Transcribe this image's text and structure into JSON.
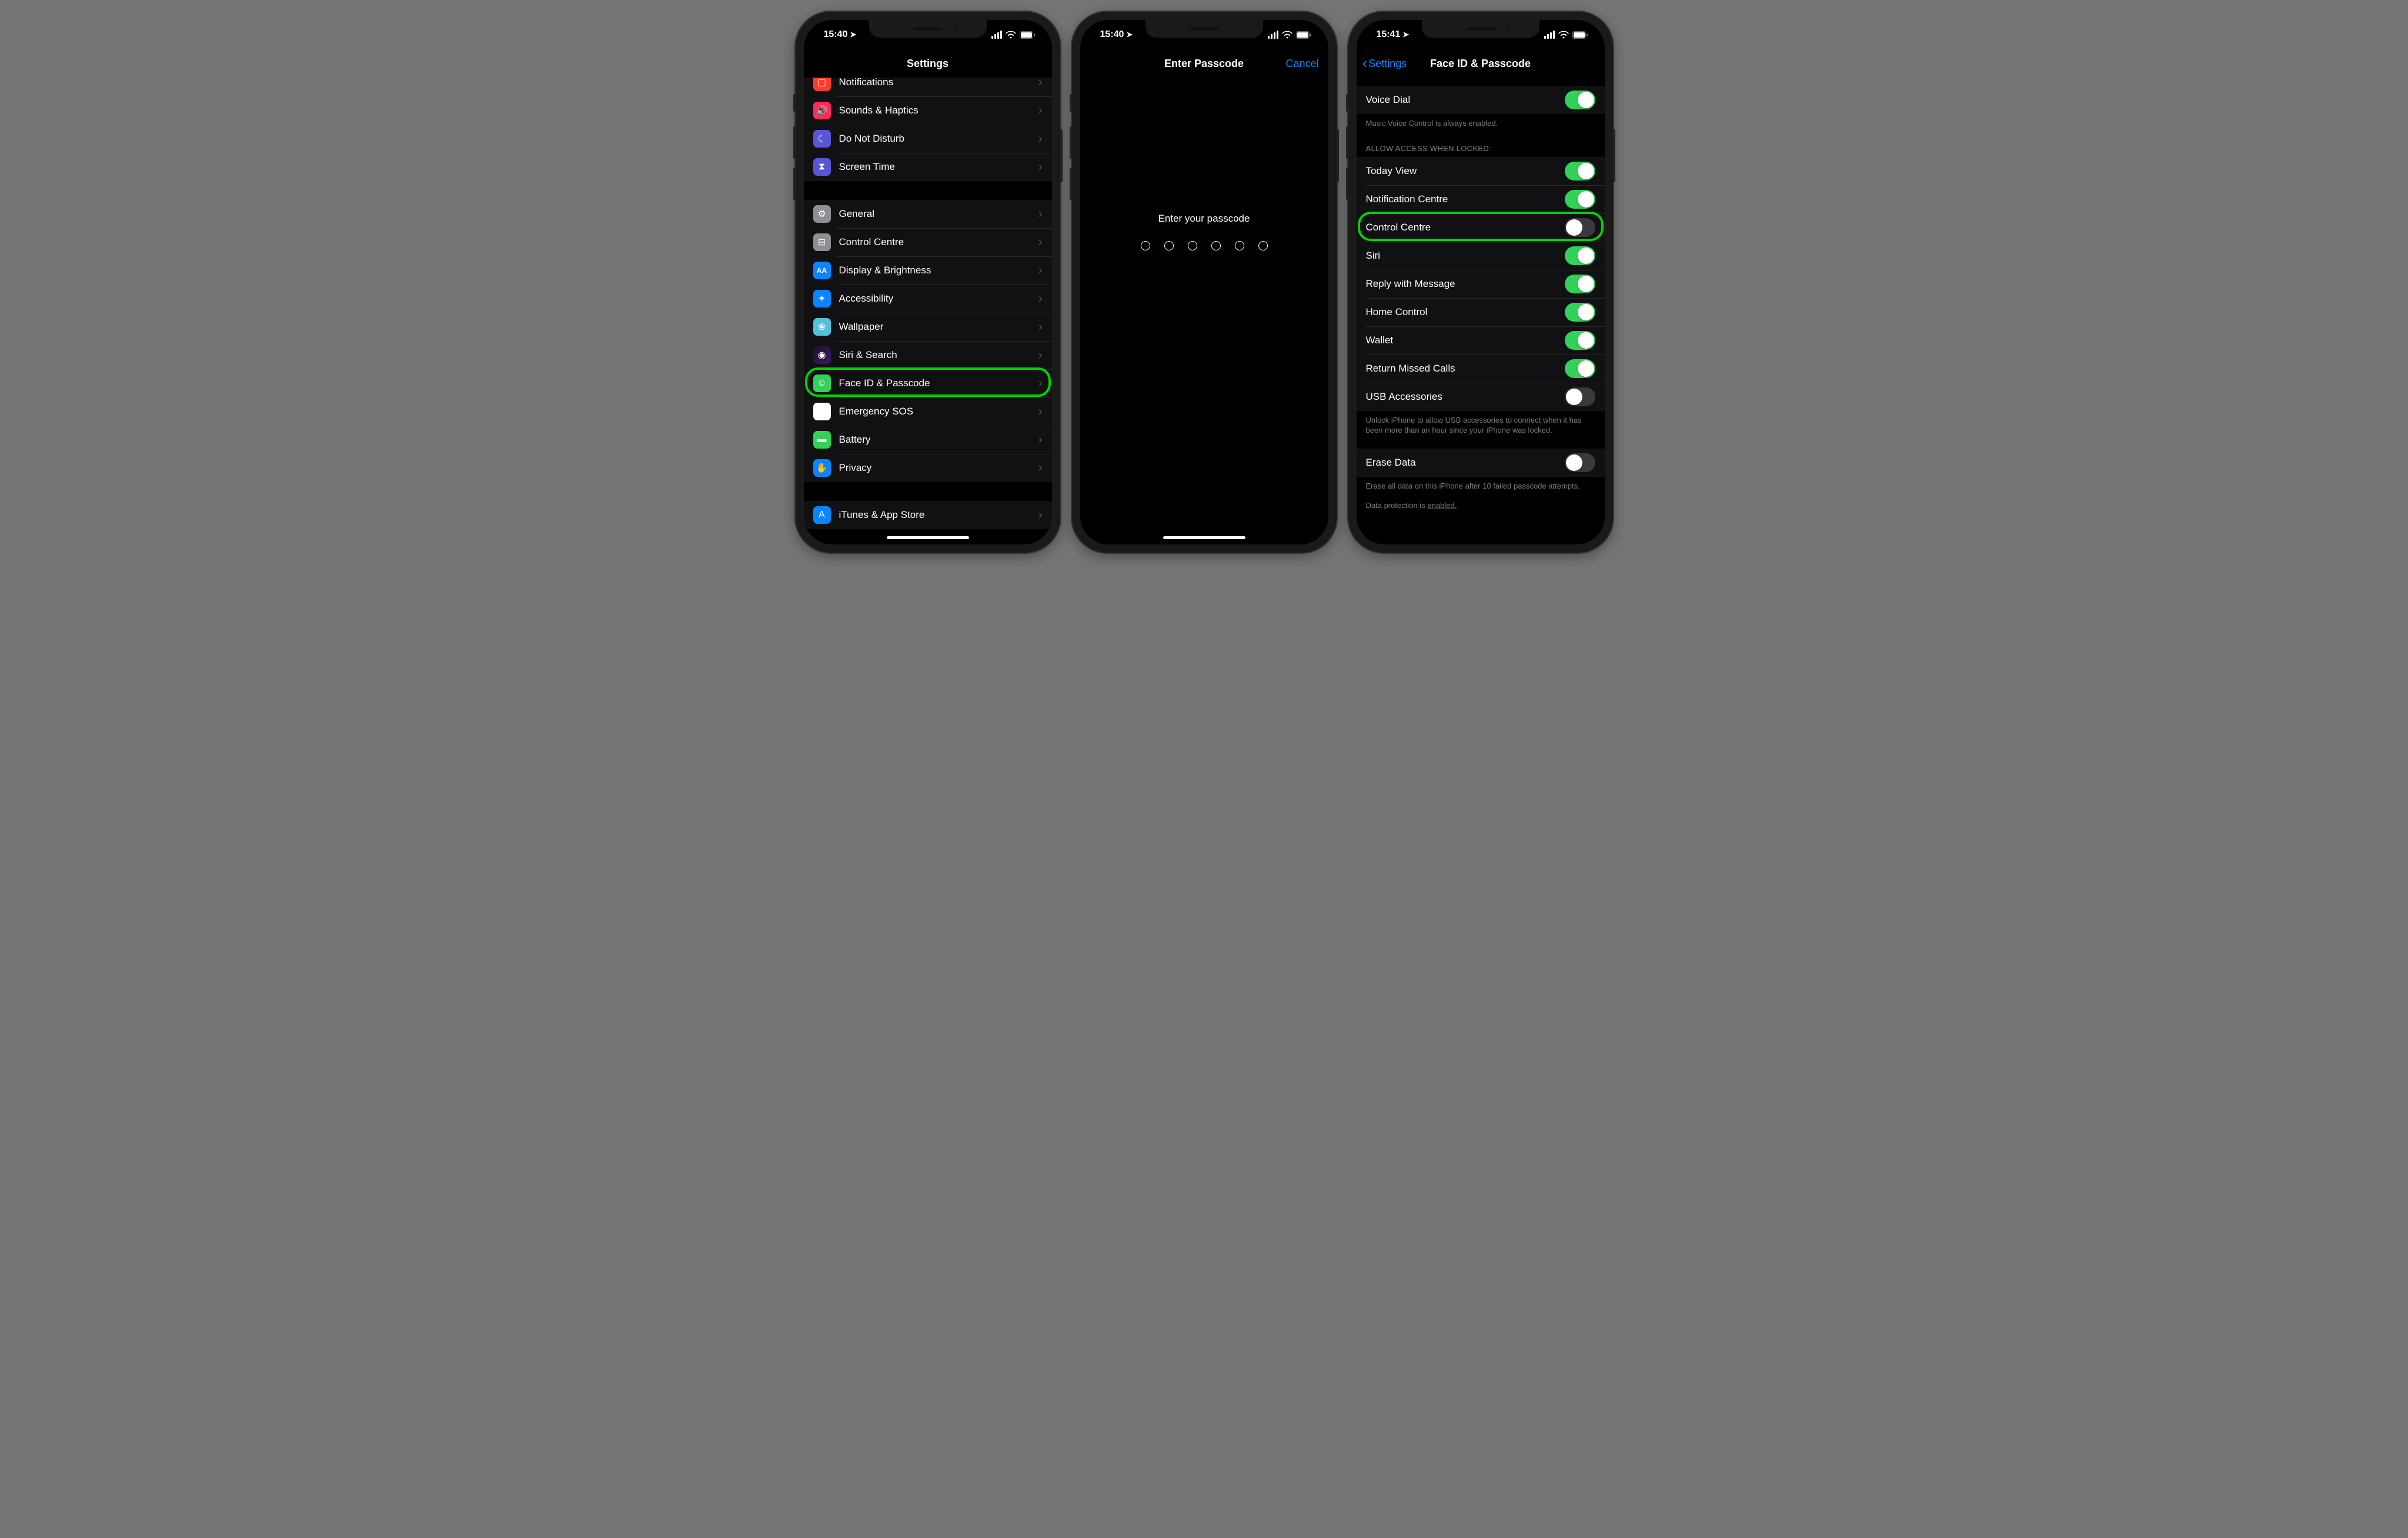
{
  "status": {
    "time_a": "15:40",
    "time_b": "15:40",
    "time_c": "15:41"
  },
  "phone1": {
    "title": "Settings",
    "rows1": [
      {
        "key": "notifications",
        "label": "Notifications",
        "icon": "bell-icon"
      },
      {
        "key": "sounds",
        "label": "Sounds & Haptics",
        "icon": "speaker-icon"
      },
      {
        "key": "dnd",
        "label": "Do Not Disturb",
        "icon": "moon-icon"
      },
      {
        "key": "screentime",
        "label": "Screen Time",
        "icon": "hourglass-icon"
      }
    ],
    "rows2": [
      {
        "key": "general",
        "label": "General",
        "icon": "gear-icon"
      },
      {
        "key": "controlcentre",
        "label": "Control Centre",
        "icon": "toggles-icon"
      },
      {
        "key": "display",
        "label": "Display & Brightness",
        "icon": "aa-icon"
      },
      {
        "key": "accessibility",
        "label": "Accessibility",
        "icon": "person-icon"
      },
      {
        "key": "wallpaper",
        "label": "Wallpaper",
        "icon": "flower-icon"
      },
      {
        "key": "siri",
        "label": "Siri & Search",
        "icon": "siri-icon"
      },
      {
        "key": "faceid",
        "label": "Face ID & Passcode",
        "icon": "face-icon"
      },
      {
        "key": "sos",
        "label": "Emergency SOS",
        "icon": "sos-icon"
      },
      {
        "key": "battery",
        "label": "Battery",
        "icon": "battery-icon"
      },
      {
        "key": "privacy",
        "label": "Privacy",
        "icon": "hand-icon"
      }
    ],
    "rows3": [
      {
        "key": "itunes",
        "label": "iTunes & App Store",
        "icon": "appstore-icon"
      }
    ],
    "highlighted": "faceid"
  },
  "phone2": {
    "title": "Enter Passcode",
    "cancel": "Cancel",
    "prompt": "Enter your passcode",
    "dots": 6
  },
  "phone3": {
    "back": "Settings",
    "title": "Face ID & Passcode",
    "voice_dial": {
      "label": "Voice Dial",
      "on": true
    },
    "voice_footer": "Music Voice Control is always enabled.",
    "allow_header": "ALLOW ACCESS WHEN LOCKED:",
    "allow_rows": [
      {
        "key": "today",
        "label": "Today View",
        "on": true
      },
      {
        "key": "notif",
        "label": "Notification Centre",
        "on": true
      },
      {
        "key": "cc",
        "label": "Control Centre",
        "on": false
      },
      {
        "key": "siri",
        "label": "Siri",
        "on": true
      },
      {
        "key": "reply",
        "label": "Reply with Message",
        "on": true
      },
      {
        "key": "home",
        "label": "Home Control",
        "on": true
      },
      {
        "key": "wallet",
        "label": "Wallet",
        "on": true
      },
      {
        "key": "missed",
        "label": "Return Missed Calls",
        "on": true
      },
      {
        "key": "usb",
        "label": "USB Accessories",
        "on": false
      }
    ],
    "usb_footer": "Unlock iPhone to allow USB accessories to connect when it has been more than an hour since your iPhone was locked.",
    "erase": {
      "label": "Erase Data",
      "on": false
    },
    "erase_footer": "Erase all data on this iPhone after 10 failed passcode attempts.",
    "dp_text_a": "Data protection is ",
    "dp_text_b": "enabled.",
    "highlighted": "cc"
  },
  "icons": {
    "bell-icon": "▢",
    "speaker-icon": "🔊",
    "moon-icon": "☾",
    "hourglass-icon": "⧗",
    "gear-icon": "⚙",
    "toggles-icon": "⊟",
    "aa-icon": "AA",
    "person-icon": "✦",
    "flower-icon": "❀",
    "siri-icon": "◉",
    "face-icon": "☺",
    "sos-icon": "SOS",
    "battery-icon": "▬",
    "hand-icon": "✋",
    "appstore-icon": "A"
  }
}
